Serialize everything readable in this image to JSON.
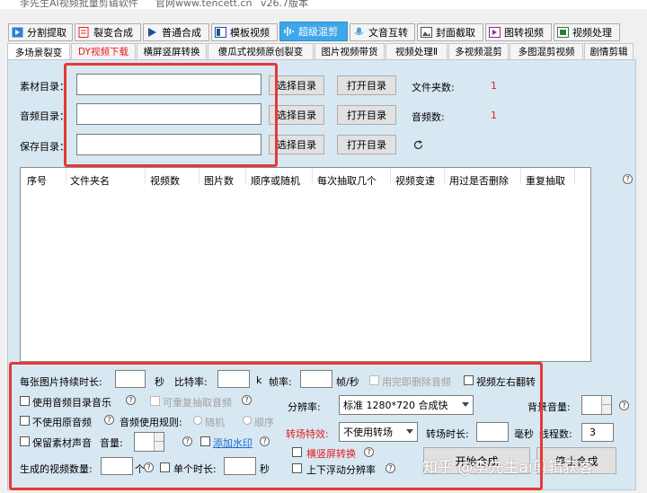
{
  "titlebar": {
    "app_title": "李先生AI视频批量剪辑软件",
    "website": "官网www.tencett.cn",
    "version": "v26.7版本"
  },
  "main_tabs": [
    {
      "label": "分割提取",
      "icon": "film-split-icon"
    },
    {
      "label": "裂变合成",
      "icon": "document-red-icon"
    },
    {
      "label": "普通合成",
      "icon": "play-triangle-icon"
    },
    {
      "label": "模板视频",
      "icon": "template-icon"
    },
    {
      "label": "超级混剪",
      "icon": "waveform-icon"
    },
    {
      "label": "文音互转",
      "icon": "microphone-icon"
    },
    {
      "label": "封面截取",
      "icon": "image-icon"
    },
    {
      "label": "图转视频",
      "icon": "slideshow-icon"
    },
    {
      "label": "视频处理",
      "icon": "video-process-icon"
    }
  ],
  "sub_tabs": [
    {
      "label": "多场景裂变"
    },
    {
      "label": "DY视频下载"
    },
    {
      "label": "横屏竖屏转换"
    },
    {
      "label": "傻瓜式视频原创裂变"
    },
    {
      "label": "图片视频带货"
    },
    {
      "label": "视频处理Ⅱ"
    },
    {
      "label": "多视频混剪"
    },
    {
      "label": "多图混剪视频"
    },
    {
      "label": "剧情剪辑"
    }
  ],
  "dirs": {
    "material_label": "素材目录：",
    "audio_label": "音频目录：",
    "save_label": "保存目录：",
    "material_value": "",
    "audio_value": "",
    "save_value": "",
    "select_btn": "选择目录",
    "open_btn": "打开目录",
    "folder_count_label": "文件夹数:",
    "folder_count": "1",
    "audio_count_label": "音频数:",
    "audio_count": "1"
  },
  "table": {
    "columns": [
      "序号",
      "文件夹名",
      "视频数",
      "图片数",
      "顺序或随机",
      "每次抽取几个",
      "视频变速",
      "用过是否删除",
      "重复抽取"
    ],
    "rows": []
  },
  "settings": {
    "img_duration_label": "每张图片持续时长:",
    "img_duration_value": "",
    "sec_unit": "秒",
    "bitrate_label": "比特率:",
    "bitrate_value": "",
    "k_unit": "k",
    "fps_label": "帧率:",
    "fps_value": "",
    "fps_unit": "帧/秒",
    "delete_audio_label": "用完即删除音频",
    "flip_label": "视频左右翻转",
    "use_audio_dir_label": "使用音频目录音乐",
    "repeat_audio_label": "可重复抽取音频",
    "resolution_label": "分辨率:",
    "resolution_value": "标准 1280*720 合成快",
    "bg_volume_label": "背景音量:",
    "no_orig_audio_label": "不使用原音频",
    "audio_rule_label": "音频使用规则:",
    "random_label": "随机",
    "order_label": "顺序",
    "transition_label": "转场特效:",
    "transition_value": "不使用转场",
    "transition_duration_label": "转场时长:",
    "ms_unit": "毫秒",
    "threads_label": "线程数:",
    "threads_value": "3",
    "keep_sound_label": "保留素材声音",
    "volume_label": "音量:",
    "add_watermark_label": "添加水印",
    "landscape_label": "横竖屏转换",
    "video_count_label": "生成的视频数量:",
    "count_unit": "个",
    "single_duration_label": "单个时长:",
    "float_res_label": "上下浮动分辨率",
    "start_btn": "开始合成",
    "stop_btn": "停止合成",
    "watermark": "知乎 @李先生ai剪辑获客"
  },
  "colors": {
    "accent": "#3fa7e8",
    "panel": "#d8e8f3",
    "highlight_box": "#e53935",
    "value_red": "#e01c1c",
    "link": "#1b6ad0"
  }
}
